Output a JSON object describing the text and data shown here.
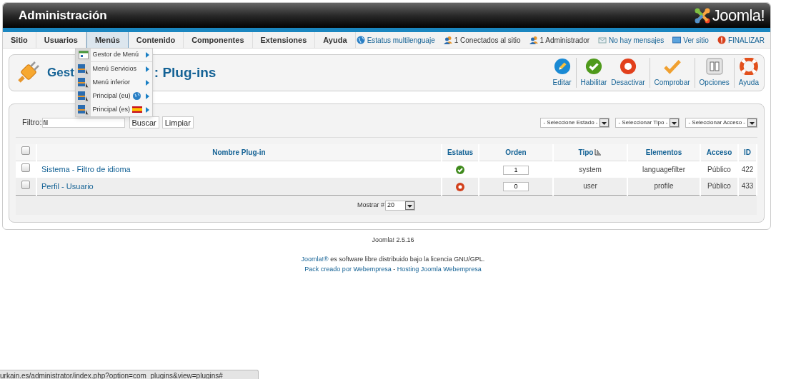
{
  "header": {
    "title": "Administración",
    "logo_text": "Joomla!"
  },
  "nav": {
    "items": [
      {
        "label": "Sitio",
        "selected": false
      },
      {
        "label": "Usuarios",
        "selected": false
      },
      {
        "label": "Menús",
        "selected": true
      },
      {
        "label": "Contenido",
        "selected": false
      },
      {
        "label": "Componentes",
        "selected": false
      },
      {
        "label": "Extensiones",
        "selected": false
      },
      {
        "label": "Ayuda",
        "selected": false
      }
    ],
    "status_links": [
      {
        "label": "Estatus multilenguaje",
        "kind": "globe"
      },
      {
        "label": "1 Conectados al sitio",
        "kind": "users"
      },
      {
        "label": "1 Administrador",
        "kind": "users"
      },
      {
        "label": "No hay mensajes",
        "kind": "mail"
      },
      {
        "label": "Ver sitio",
        "kind": "screen"
      },
      {
        "label": "FINALIZAR",
        "kind": "logout"
      }
    ]
  },
  "dropdown": {
    "items": [
      {
        "label": "Gestor de Menú",
        "kind": "manager"
      },
      {
        "label": "Menú Servicios",
        "kind": "menu"
      },
      {
        "label": "Menú inferior",
        "kind": "menu"
      },
      {
        "label": "Principal (eu)",
        "kind": "menu-globe"
      },
      {
        "label": "Principal (es)",
        "kind": "menu-flag"
      }
    ]
  },
  "toolbar": {
    "title_start": "Gest",
    "title_end": ": Plug-ins",
    "groups": [
      {
        "buttons": [
          {
            "label": "Editar",
            "kind": "edit"
          }
        ]
      },
      {
        "buttons": [
          {
            "label": "Habilitar",
            "kind": "enable"
          },
          {
            "label": "Desactivar",
            "kind": "disable"
          }
        ]
      },
      {
        "buttons": [
          {
            "label": "Comprobar",
            "kind": "check"
          }
        ]
      },
      {
        "buttons": [
          {
            "label": "Opciones",
            "kind": "options"
          }
        ]
      },
      {
        "buttons": [
          {
            "label": "Ayuda",
            "kind": "help"
          }
        ]
      }
    ]
  },
  "filter": {
    "label": "Filtro:",
    "value": "fil",
    "buttons": [
      "Buscar",
      "Limpiar"
    ],
    "selects": [
      "- Seleccione Estado -",
      "- Seleccionar Tipo -",
      "- Seleccionar Acceso -"
    ]
  },
  "table": {
    "select_all": {
      "checked": false
    },
    "columns": [
      {
        "label": "Nombre Plug-in",
        "sorted": false
      },
      {
        "label": "Estatus",
        "sorted": false
      },
      {
        "label": "Orden",
        "sorted": false
      },
      {
        "label": "Tipo",
        "sorted": true
      },
      {
        "label": "Elementos",
        "sorted": false
      },
      {
        "label": "Acceso",
        "sorted": false
      },
      {
        "label": "ID",
        "sorted": false
      }
    ],
    "rows": [
      {
        "checked": false,
        "name": "Sistema - Filtro de idioma",
        "enabled": true,
        "order": "1",
        "type": "system",
        "element": "languagefilter",
        "access": "Público",
        "id": "422"
      },
      {
        "checked": false,
        "name": "Perfil - Usuario",
        "enabled": false,
        "order": "0",
        "type": "user",
        "element": "profile",
        "access": "Público",
        "id": "433"
      }
    ],
    "pagination": {
      "label": "Mostrar #",
      "value": "20"
    }
  },
  "footer": {
    "version": "Joomla! 2.5.16",
    "license_link": "Joomla!®",
    "license_text": " es software libre distribuido bajo la licencia GNU/GPL.",
    "credits": [
      {
        "label": "Pack creado por Webempresa"
      },
      {
        "label": "Hosting Joomla Webempresa"
      }
    ],
    "credits_separator": " - "
  },
  "status_bar": {
    "url": "urkain.es/administrator/index.php?option=com_plugins&view=plugins#"
  }
}
